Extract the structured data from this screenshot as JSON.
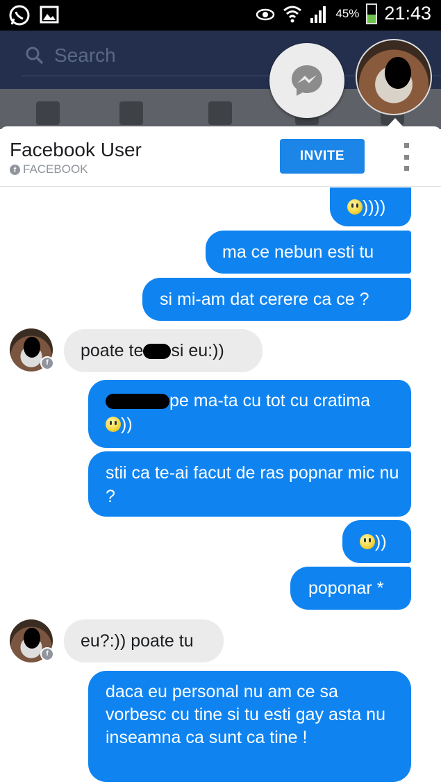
{
  "status_bar": {
    "battery": "45%",
    "battery_level": 0.45,
    "time": "21:43"
  },
  "background_app": {
    "search_placeholder": "Search"
  },
  "chat": {
    "contact_name": "Facebook User",
    "contact_source": "FACEBOOK",
    "invite_label": "INVITE"
  },
  "messages": [
    {
      "dir": "out",
      "text": "))))",
      "emoji_prefix": true
    },
    {
      "dir": "out",
      "text": "ma ce nebun esti tu"
    },
    {
      "dir": "out",
      "text": "si mi-am dat cerere ca ce ?"
    },
    {
      "dir": "in",
      "text_a": "poate te",
      "text_b": "si eu:))"
    },
    {
      "dir": "out",
      "text_a": "pe ma-ta cu tot cu cratima",
      "text_b": "))"
    },
    {
      "dir": "out",
      "text": "stii ca te-ai facut de ras popnar mic nu ?"
    },
    {
      "dir": "out",
      "text": "))",
      "emoji_prefix": true
    },
    {
      "dir": "out",
      "text": "poponar *"
    },
    {
      "dir": "in",
      "text": "eu?:)) poate tu"
    },
    {
      "dir": "out",
      "text": "daca eu personal nu am ce sa vorbesc cu tine si tu esti gay asta nu inseamna ca sunt ca tine !"
    }
  ],
  "colors": {
    "outgoing": "#0f84f1",
    "incoming": "#ebebeb",
    "invite": "#1b86e8",
    "fb_bar": "#232f4c"
  }
}
